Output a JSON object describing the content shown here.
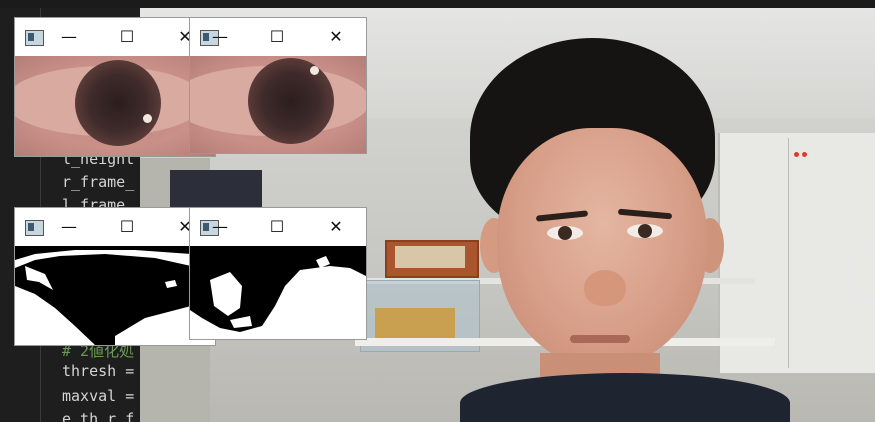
{
  "editor": {
    "lines": [
      {
        "text": "l_height",
        "style": "code"
      },
      {
        "text": "r_frame_",
        "style": "code"
      },
      {
        "text": "l_frame_",
        "style": "code"
      },
      {
        "text": "# 2値化処",
        "style": "comment"
      },
      {
        "text": "thresh =",
        "style": "code"
      },
      {
        "text": "maxval =",
        "style": "code"
      },
      {
        "text": "e_th_r_f",
        "style": "code"
      }
    ]
  },
  "windows": {
    "controls": {
      "minimize": "—",
      "maximize": "☐",
      "close": "✕"
    },
    "icon": "app-window-icon",
    "items": [
      {
        "name": "right-eye-window",
        "kind": "color"
      },
      {
        "name": "left-eye-window",
        "kind": "color"
      },
      {
        "name": "right-eye-binary-window",
        "kind": "binary"
      },
      {
        "name": "left-eye-binary-window",
        "kind": "binary"
      }
    ]
  },
  "camera": {
    "name": "camera-feed",
    "led_color": "#e03a2a"
  }
}
